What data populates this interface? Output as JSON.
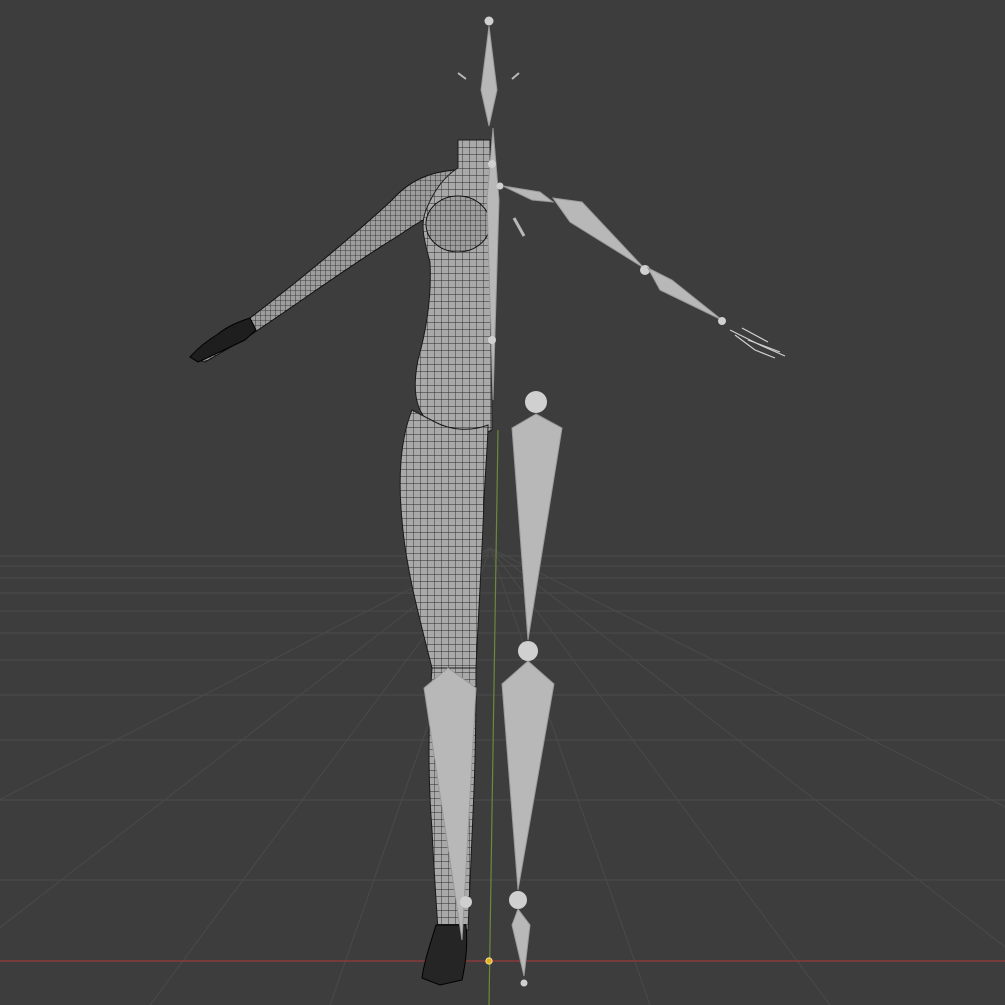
{
  "viewport": {
    "background": "#3d3d3d",
    "grid_color": "#4a4a4a",
    "x_axis_color": "#8a3a3a",
    "y_axis_color": "#6b8a3a",
    "origin_color": "#e0b020"
  },
  "armature": {
    "bone_color": "#b8b8b8",
    "joint_color": "#d0d0d0",
    "display": "octahedral"
  },
  "mesh": {
    "display": "wireframe-overlay",
    "surface_color": "#b5b5b5",
    "wire_color": "#2a2a2a"
  }
}
